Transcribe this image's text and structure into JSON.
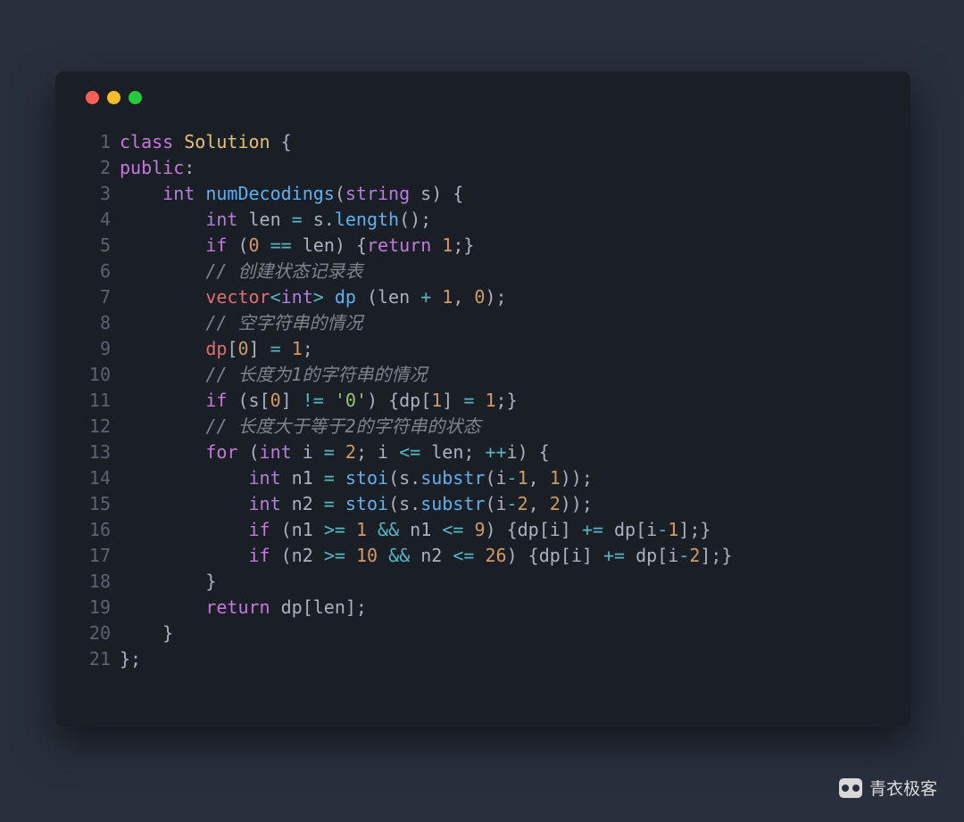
{
  "watermark": "青衣极客",
  "traffic": {
    "red": "#ff5f56",
    "yellow": "#ffbd2e",
    "green": "#27c93f"
  },
  "code_lines": [
    [
      {
        "t": "class ",
        "c": "kw"
      },
      {
        "t": "Solution",
        "c": "cls"
      },
      {
        "t": " {",
        "c": "pn"
      }
    ],
    [
      {
        "t": "public",
        "c": "kw"
      },
      {
        "t": ":",
        "c": "pn"
      }
    ],
    [
      {
        "t": "    ",
        "c": "pn"
      },
      {
        "t": "int",
        "c": "ty"
      },
      {
        "t": " ",
        "c": "pn"
      },
      {
        "t": "numDecodings",
        "c": "fn2"
      },
      {
        "t": "(",
        "c": "pn"
      },
      {
        "t": "string",
        "c": "ty"
      },
      {
        "t": " s) {",
        "c": "pn"
      }
    ],
    [
      {
        "t": "        ",
        "c": "pn"
      },
      {
        "t": "int",
        "c": "ty"
      },
      {
        "t": " len ",
        "c": "pn"
      },
      {
        "t": "=",
        "c": "op"
      },
      {
        "t": " s.",
        "c": "pn"
      },
      {
        "t": "length",
        "c": "fn2"
      },
      {
        "t": "();",
        "c": "pn"
      }
    ],
    [
      {
        "t": "        ",
        "c": "pn"
      },
      {
        "t": "if",
        "c": "kw"
      },
      {
        "t": " (",
        "c": "pn"
      },
      {
        "t": "0",
        "c": "num"
      },
      {
        "t": " ",
        "c": "pn"
      },
      {
        "t": "==",
        "c": "op"
      },
      {
        "t": " len) {",
        "c": "pn"
      },
      {
        "t": "return",
        "c": "kw"
      },
      {
        "t": " ",
        "c": "pn"
      },
      {
        "t": "1",
        "c": "num"
      },
      {
        "t": ";}",
        "c": "pn"
      }
    ],
    [
      {
        "t": "        ",
        "c": "pn"
      },
      {
        "t": "// 创建状态记录表",
        "c": "cm"
      }
    ],
    [
      {
        "t": "        ",
        "c": "pn"
      },
      {
        "t": "vector",
        "c": "id"
      },
      {
        "t": "<",
        "c": "op"
      },
      {
        "t": "int",
        "c": "ty"
      },
      {
        "t": ">",
        "c": "op"
      },
      {
        "t": " ",
        "c": "pn"
      },
      {
        "t": "dp",
        "c": "fn2"
      },
      {
        "t": " (len ",
        "c": "pn"
      },
      {
        "t": "+",
        "c": "op"
      },
      {
        "t": " ",
        "c": "pn"
      },
      {
        "t": "1",
        "c": "num"
      },
      {
        "t": ", ",
        "c": "pn"
      },
      {
        "t": "0",
        "c": "num"
      },
      {
        "t": ");",
        "c": "pn"
      }
    ],
    [
      {
        "t": "        ",
        "c": "pn"
      },
      {
        "t": "// 空字符串的情况",
        "c": "cm"
      }
    ],
    [
      {
        "t": "        ",
        "c": "pn"
      },
      {
        "t": "dp",
        "c": "id"
      },
      {
        "t": "[",
        "c": "pn"
      },
      {
        "t": "0",
        "c": "num"
      },
      {
        "t": "] ",
        "c": "pn"
      },
      {
        "t": "=",
        "c": "op"
      },
      {
        "t": " ",
        "c": "pn"
      },
      {
        "t": "1",
        "c": "num"
      },
      {
        "t": ";",
        "c": "pn"
      }
    ],
    [
      {
        "t": "        ",
        "c": "pn"
      },
      {
        "t": "// 长度为1的字符串的情况",
        "c": "cm"
      }
    ],
    [
      {
        "t": "        ",
        "c": "pn"
      },
      {
        "t": "if",
        "c": "kw"
      },
      {
        "t": " (s[",
        "c": "pn"
      },
      {
        "t": "0",
        "c": "num"
      },
      {
        "t": "] ",
        "c": "pn"
      },
      {
        "t": "!=",
        "c": "op"
      },
      {
        "t": " ",
        "c": "pn"
      },
      {
        "t": "'0'",
        "c": "str"
      },
      {
        "t": ") {dp[",
        "c": "pn"
      },
      {
        "t": "1",
        "c": "num"
      },
      {
        "t": "] ",
        "c": "pn"
      },
      {
        "t": "=",
        "c": "op"
      },
      {
        "t": " ",
        "c": "pn"
      },
      {
        "t": "1",
        "c": "num"
      },
      {
        "t": ";}",
        "c": "pn"
      }
    ],
    [
      {
        "t": "        ",
        "c": "pn"
      },
      {
        "t": "// 长度大于等于2的字符串的状态",
        "c": "cm"
      }
    ],
    [
      {
        "t": "        ",
        "c": "pn"
      },
      {
        "t": "for",
        "c": "kw"
      },
      {
        "t": " (",
        "c": "pn"
      },
      {
        "t": "int",
        "c": "ty"
      },
      {
        "t": " i ",
        "c": "pn"
      },
      {
        "t": "=",
        "c": "op"
      },
      {
        "t": " ",
        "c": "pn"
      },
      {
        "t": "2",
        "c": "num"
      },
      {
        "t": "; i ",
        "c": "pn"
      },
      {
        "t": "<=",
        "c": "op"
      },
      {
        "t": " len; ",
        "c": "pn"
      },
      {
        "t": "++",
        "c": "op"
      },
      {
        "t": "i) {",
        "c": "pn"
      }
    ],
    [
      {
        "t": "            ",
        "c": "pn"
      },
      {
        "t": "int",
        "c": "ty"
      },
      {
        "t": " n1 ",
        "c": "pn"
      },
      {
        "t": "=",
        "c": "op"
      },
      {
        "t": " ",
        "c": "pn"
      },
      {
        "t": "stoi",
        "c": "fn2"
      },
      {
        "t": "(s.",
        "c": "pn"
      },
      {
        "t": "substr",
        "c": "fn2"
      },
      {
        "t": "(i",
        "c": "pn"
      },
      {
        "t": "-",
        "c": "op"
      },
      {
        "t": "1",
        "c": "num"
      },
      {
        "t": ", ",
        "c": "pn"
      },
      {
        "t": "1",
        "c": "num"
      },
      {
        "t": "));",
        "c": "pn"
      }
    ],
    [
      {
        "t": "            ",
        "c": "pn"
      },
      {
        "t": "int",
        "c": "ty"
      },
      {
        "t": " n2 ",
        "c": "pn"
      },
      {
        "t": "=",
        "c": "op"
      },
      {
        "t": " ",
        "c": "pn"
      },
      {
        "t": "stoi",
        "c": "fn2"
      },
      {
        "t": "(s.",
        "c": "pn"
      },
      {
        "t": "substr",
        "c": "fn2"
      },
      {
        "t": "(i",
        "c": "pn"
      },
      {
        "t": "-",
        "c": "op"
      },
      {
        "t": "2",
        "c": "num"
      },
      {
        "t": ", ",
        "c": "pn"
      },
      {
        "t": "2",
        "c": "num"
      },
      {
        "t": "));",
        "c": "pn"
      }
    ],
    [
      {
        "t": "            ",
        "c": "pn"
      },
      {
        "t": "if",
        "c": "kw"
      },
      {
        "t": " (n1 ",
        "c": "pn"
      },
      {
        "t": ">=",
        "c": "op"
      },
      {
        "t": " ",
        "c": "pn"
      },
      {
        "t": "1",
        "c": "num"
      },
      {
        "t": " ",
        "c": "pn"
      },
      {
        "t": "&&",
        "c": "op"
      },
      {
        "t": " n1 ",
        "c": "pn"
      },
      {
        "t": "<=",
        "c": "op"
      },
      {
        "t": " ",
        "c": "pn"
      },
      {
        "t": "9",
        "c": "num"
      },
      {
        "t": ") {dp[i] ",
        "c": "pn"
      },
      {
        "t": "+=",
        "c": "op"
      },
      {
        "t": " dp[i",
        "c": "pn"
      },
      {
        "t": "-",
        "c": "op"
      },
      {
        "t": "1",
        "c": "num"
      },
      {
        "t": "];}",
        "c": "pn"
      }
    ],
    [
      {
        "t": "            ",
        "c": "pn"
      },
      {
        "t": "if",
        "c": "kw"
      },
      {
        "t": " (n2 ",
        "c": "pn"
      },
      {
        "t": ">=",
        "c": "op"
      },
      {
        "t": " ",
        "c": "pn"
      },
      {
        "t": "10",
        "c": "num"
      },
      {
        "t": " ",
        "c": "pn"
      },
      {
        "t": "&&",
        "c": "op"
      },
      {
        "t": " n2 ",
        "c": "pn"
      },
      {
        "t": "<=",
        "c": "op"
      },
      {
        "t": " ",
        "c": "pn"
      },
      {
        "t": "26",
        "c": "num"
      },
      {
        "t": ") {dp[i] ",
        "c": "pn"
      },
      {
        "t": "+=",
        "c": "op"
      },
      {
        "t": " dp[i",
        "c": "pn"
      },
      {
        "t": "-",
        "c": "op"
      },
      {
        "t": "2",
        "c": "num"
      },
      {
        "t": "];}",
        "c": "pn"
      }
    ],
    [
      {
        "t": "        }",
        "c": "pn"
      }
    ],
    [
      {
        "t": "        ",
        "c": "pn"
      },
      {
        "t": "return",
        "c": "kw"
      },
      {
        "t": " dp[len];",
        "c": "pn"
      }
    ],
    [
      {
        "t": "    }",
        "c": "pn"
      }
    ],
    [
      {
        "t": "};",
        "c": "pn"
      }
    ]
  ]
}
